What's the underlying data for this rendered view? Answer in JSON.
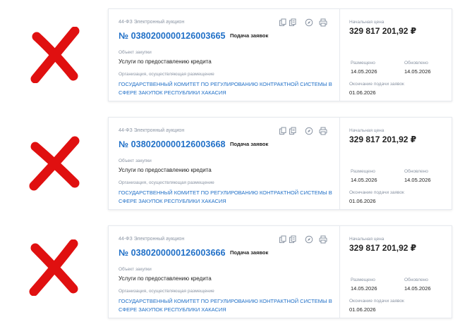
{
  "colors": {
    "cross": "#e01010",
    "link": "#1f6fc7",
    "label": "#8a94a3",
    "text": "#222222",
    "border": "#e6e9ee"
  },
  "cards": [
    {
      "law": "44-ФЗ Электронный аукцион",
      "number": "№ 0380200000126003665",
      "stage": "Подача заявок",
      "subject_label": "Объект закупки",
      "subject": "Услуги по предоставлению кредита",
      "org_label": "Организация, осуществляющая размещение",
      "org": "ГОСУДАРСТВЕННЫЙ КОМИТЕТ ПО РЕГУЛИРОВАНИЮ КОНТРАКТНОЙ СИСТЕМЫ В СФЕРЕ ЗАКУПОК РЕСПУБЛИКИ ХАКАСИЯ",
      "price_label": "Начальная цена",
      "price": "329 817 201,92 ₽",
      "published_label": "Размещено",
      "published": "14.05.2026",
      "updated_label": "Обновлено",
      "updated": "14.05.2026",
      "end_label": "Окончание подачи заявок",
      "end": "01.06.2026",
      "icons": [
        "copy-icon",
        "document-copy-icon",
        "compass-icon",
        "print-icon"
      ]
    },
    {
      "law": "44-ФЗ Электронный аукцион",
      "number": "№ 0380200000126003668",
      "stage": "Подача заявок",
      "subject_label": "Объект закупки",
      "subject": "Услуги по предоставлению кредита",
      "org_label": "Организация, осуществляющая размещение",
      "org": "ГОСУДАРСТВЕННЫЙ КОМИТЕТ ПО РЕГУЛИРОВАНИЮ КОНТРАКТНОЙ СИСТЕМЫ В СФЕРЕ ЗАКУПОК РЕСПУБЛИКИ ХАКАСИЯ",
      "price_label": "Начальная цена",
      "price": "329 817 201,92 ₽",
      "published_label": "Размещено",
      "published": "14.05.2026",
      "updated_label": "Обновлено",
      "updated": "14.05.2026",
      "end_label": "Окончание подачи заявок",
      "end": "01.06.2026",
      "icons": [
        "copy-icon",
        "document-copy-icon",
        "compass-icon",
        "print-icon"
      ]
    },
    {
      "law": "44-ФЗ Электронный аукцион",
      "number": "№ 0380200000126003666",
      "stage": "Подача заявок",
      "subject_label": "Объект закупки",
      "subject": "Услуги по предоставлению кредита",
      "org_label": "Организация, осуществляющая размещение",
      "org": "ГОСУДАРСТВЕННЫЙ КОМИТЕТ ПО РЕГУЛИРОВАНИЮ КОНТРАКТНОЙ СИСТЕМЫ В СФЕРЕ ЗАКУПОК РЕСПУБЛИКИ ХАКАСИЯ",
      "price_label": "Начальная цена",
      "price": "329 817 201,92 ₽",
      "published_label": "Размещено",
      "published": "14.05.2026",
      "updated_label": "Обновлено",
      "updated": "14.05.2026",
      "end_label": "Окончание подачи заявок",
      "end": "01.06.2026",
      "icons": [
        "copy-icon",
        "document-copy-icon",
        "compass-icon",
        "print-icon"
      ]
    }
  ]
}
